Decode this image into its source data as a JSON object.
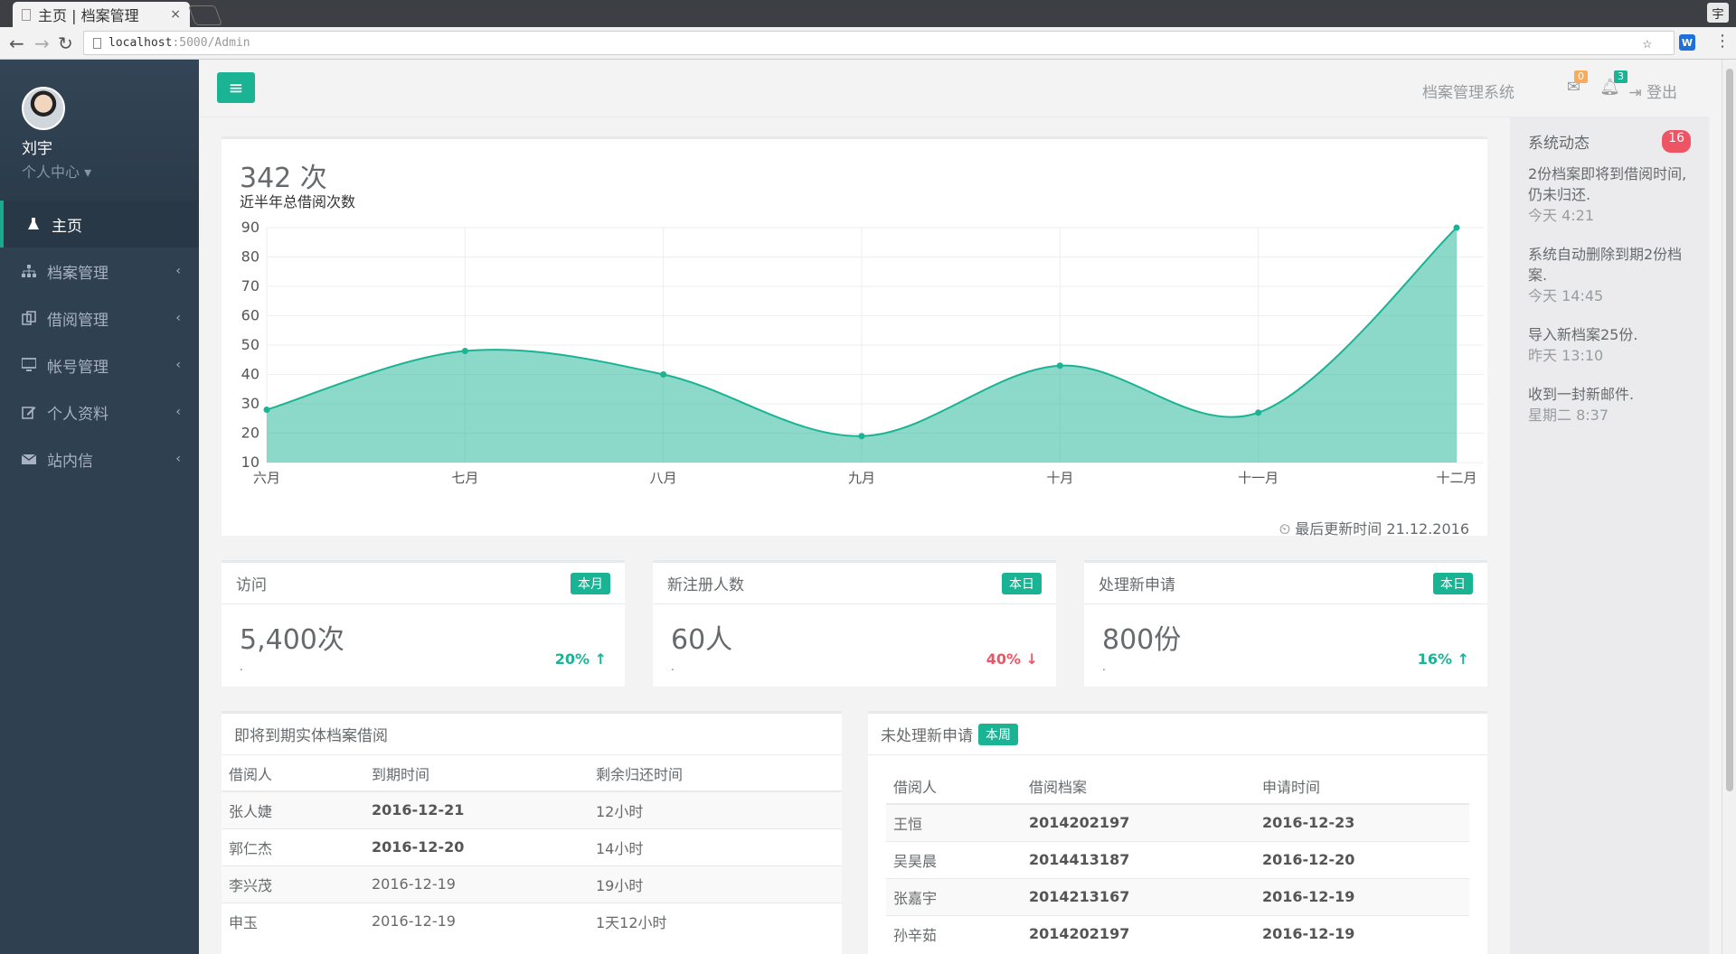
{
  "browser": {
    "tab_title": "主页 | 档案管理",
    "tab_close": "×",
    "url_host": "localhost",
    "url_rest": ":5000/Admin",
    "profile_letter": "宇"
  },
  "sidebar": {
    "user_name": "刘宇",
    "user_menu": "个人中心 ▾",
    "items": [
      {
        "label": "主页",
        "icon": "flask-icon",
        "active": true
      },
      {
        "label": "档案管理",
        "icon": "sitemap-icon"
      },
      {
        "label": "借阅管理",
        "icon": "copy-icon"
      },
      {
        "label": "帐号管理",
        "icon": "desktop-icon"
      },
      {
        "label": "个人资料",
        "icon": "edit-icon"
      },
      {
        "label": "站内信",
        "icon": "envelope-icon"
      }
    ]
  },
  "topnav": {
    "system_name": "档案管理系统",
    "mail_count": "0",
    "bell_count": "3",
    "logout_label": "登出",
    "colors": {
      "accent": "#1ab394",
      "mail_badge": "#f8ac59",
      "bell_badge": "#1ab394"
    }
  },
  "chart_panel": {
    "total": "342 次",
    "subtitle": "近半年总借阅次数",
    "updated": "最后更新时间 21.12.2016"
  },
  "chart_data": {
    "type": "area",
    "categories": [
      "六月",
      "七月",
      "八月",
      "九月",
      "十月",
      "十一月",
      "十二月"
    ],
    "values": [
      28,
      48,
      40,
      19,
      43,
      27,
      90
    ],
    "ylim": [
      10,
      90
    ],
    "yticks": [
      10,
      20,
      30,
      40,
      50,
      60,
      70,
      80,
      90
    ],
    "grid": true,
    "color": "#1ab394"
  },
  "stats": [
    {
      "title": "访问",
      "badge": "本月",
      "value": "5,400次",
      "pct": "20%",
      "dir": "up",
      "color": "#1ab394"
    },
    {
      "title": "新注册人数",
      "badge": "本日",
      "value": "60人",
      "pct": "40%",
      "dir": "down",
      "color": "#ed5565"
    },
    {
      "title": "处理新申请",
      "badge": "本日",
      "value": "800份",
      "pct": "16%",
      "dir": "up",
      "color": "#1ab394"
    }
  ],
  "due_table": {
    "title": "即将到期实体档案借阅",
    "headers": [
      "借阅人",
      "到期时间",
      "剩余归还时间"
    ],
    "rows": [
      [
        "张人婕",
        "2016-12-21",
        "12小时"
      ],
      [
        "郭仁杰",
        "2016-12-20",
        "14小时"
      ],
      [
        "李兴茂",
        "2016-12-19",
        "19小时"
      ],
      [
        "申玉",
        "2016-12-19",
        "1天12小时"
      ]
    ]
  },
  "pending_table": {
    "title": "未处理新申请",
    "badge": "本周",
    "headers": [
      "借阅人",
      "借阅档案",
      "申请时间"
    ],
    "rows": [
      [
        "王恒",
        "2014202197",
        "2016-12-23"
      ],
      [
        "吴昊晨",
        "2014413187",
        "2016-12-20"
      ],
      [
        "张嘉宇",
        "2014213167",
        "2016-12-19"
      ],
      [
        "孙辛茹",
        "2014202197",
        "2016-12-19"
      ]
    ]
  },
  "right_sidebar": {
    "title": "系统动态",
    "badge": "16",
    "feed": [
      {
        "text": "2份档案即将到借阅时间,仍未归还.",
        "time": "今天 4:21"
      },
      {
        "text": "系统自动删除到期2份档案.",
        "time": "今天 14:45"
      },
      {
        "text": "导入新档案25份.",
        "time": "昨天 13:10"
      },
      {
        "text": "收到一封新邮件.",
        "time": "星期二 8:37"
      }
    ]
  }
}
